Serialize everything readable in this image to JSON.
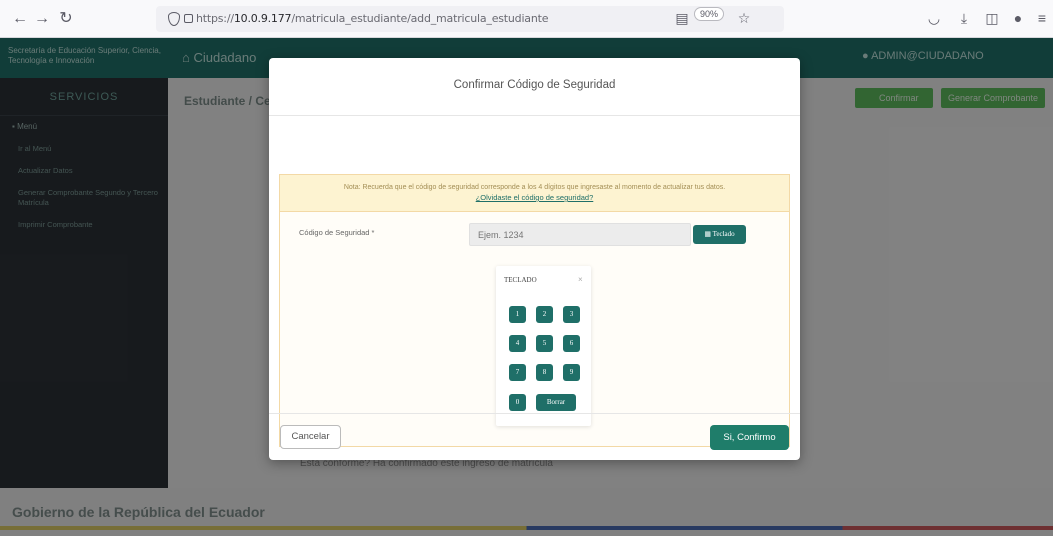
{
  "browser": {
    "url_prefix": "https://",
    "url_host": "10.0.9.177",
    "url_path": "/matricula_estudiante/add_matricula_estudiante",
    "zoom": "90%"
  },
  "app": {
    "brand": "Secretaría de Educación Superior, Ciencia, Tecnología e Innovación",
    "home": "Ciudadano",
    "user": "ADMIN@CIUDADANO"
  },
  "sidebar": {
    "title": "SERVICIOS",
    "menu": "Menú",
    "items": [
      "Ir al Menú",
      "Actualizar Datos",
      "Generar Comprobante Segundo y Tercero Matrícula",
      "Imprimir Comprobante"
    ]
  },
  "main": {
    "breadcrumb": "Estudiante / Ce",
    "confirm_label": "Confirmar",
    "generate_label": "Generar Comprobante",
    "bottom_note": "Está conforme? Ha confirmado este ingreso de matrícula"
  },
  "footer": {
    "title": "Gobierno de la República del Ecuador"
  },
  "modal": {
    "title": "Confirmar Código de Seguridad",
    "note": "Nota: Recuerda que el código de seguridad corresponde a los 4 dígitos que ingresaste al momento de actualizar tus datos.",
    "forgot_link": "¿Olvidaste el código de seguridad?",
    "code_label": "Código de Seguridad *",
    "code_placeholder": "Ejem. 1234",
    "keyboard_button": "Teclado",
    "keypad_title": "TECLADO",
    "keypad_close": "×",
    "keys": [
      "1",
      "2",
      "3",
      "4",
      "5",
      "6",
      "7",
      "8",
      "9",
      "0"
    ],
    "delete_key": "Borrar",
    "cancel": "Cancelar",
    "confirm": "Si, Confirmo"
  }
}
